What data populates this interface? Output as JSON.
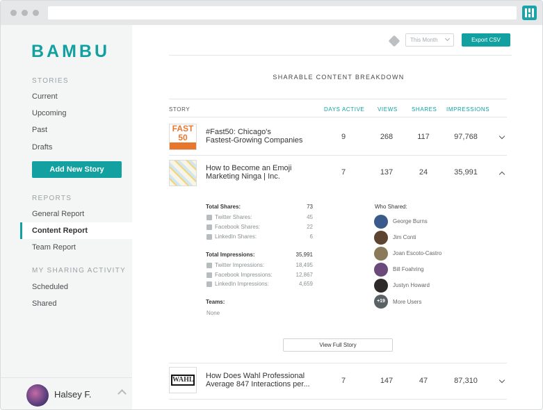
{
  "brand": {
    "logo": "BAMBU",
    "accent": "#12a1a0"
  },
  "sidebar": {
    "stories_heading": "STORIES",
    "stories": [
      "Current",
      "Upcoming",
      "Past",
      "Drafts"
    ],
    "add_button": "Add New Story",
    "reports_heading": "REPORTS",
    "reports": [
      "General Report",
      "Content Report",
      "Team Report"
    ],
    "active_report": "Content Report",
    "activity_heading": "MY SHARING ACTIVITY",
    "activity": [
      "Scheduled",
      "Shared"
    ],
    "user": {
      "name": "Halsey F."
    }
  },
  "toolbar": {
    "filter": "This Month",
    "export": "Export CSV"
  },
  "report": {
    "heading": "SHARABLE CONTENT BREAKDOWN",
    "columns": {
      "story": "STORY",
      "days_active": "DAYS ACTIVE",
      "views": "VIEWS",
      "shares": "SHARES",
      "impressions": "IMPRESSIONS"
    },
    "rows": [
      {
        "title_line1": "#Fast50: Chicago's",
        "title_line2": "Fastest-Growing Companies",
        "days": "9",
        "views": "268",
        "shares": "117",
        "impressions": "97,768",
        "thumb_text": "FAST 50"
      },
      {
        "title_line1": "How to Become an Emoji",
        "title_line2": "Marketing Ninga | Inc.",
        "days": "7",
        "views": "137",
        "shares": "24",
        "impressions": "35,991"
      },
      {
        "title_line1": "How Does Wahl Professional",
        "title_line2": "Average 847 Interactions per...",
        "days": "7",
        "views": "147",
        "shares": "47",
        "impressions": "87,310",
        "thumb_text": "WAHL"
      }
    ],
    "detail": {
      "total_shares_label": "Total Shares:",
      "total_shares": "73",
      "twitter_shares_label": "Twitter Shares:",
      "twitter_shares": "45",
      "facebook_shares_label": "Facebook Shares:",
      "facebook_shares": "22",
      "linkedin_shares_label": "LinkedIn Shares:",
      "linkedin_shares": "6",
      "total_impr_label": "Total Impressions:",
      "total_impr": "35,991",
      "twitter_impr_label": "Twitter Impressions:",
      "twitter_impr": "18,495",
      "facebook_impr_label": "Facebook Impressions:",
      "facebook_impr": "12,867",
      "linkedin_impr_label": "LinkedIn Impressions:",
      "linkedin_impr": "4,659",
      "teams_label": "Teams:",
      "teams_value": "None",
      "who_label": "Who Shared:",
      "people": [
        "George Burns",
        "Jim Conti",
        "Joan Escoto-Castro",
        "Bill Foahring",
        "Justyn Howard"
      ],
      "more_badge": "+19",
      "more_label": "More Users",
      "view_full": "View Full Story"
    }
  }
}
